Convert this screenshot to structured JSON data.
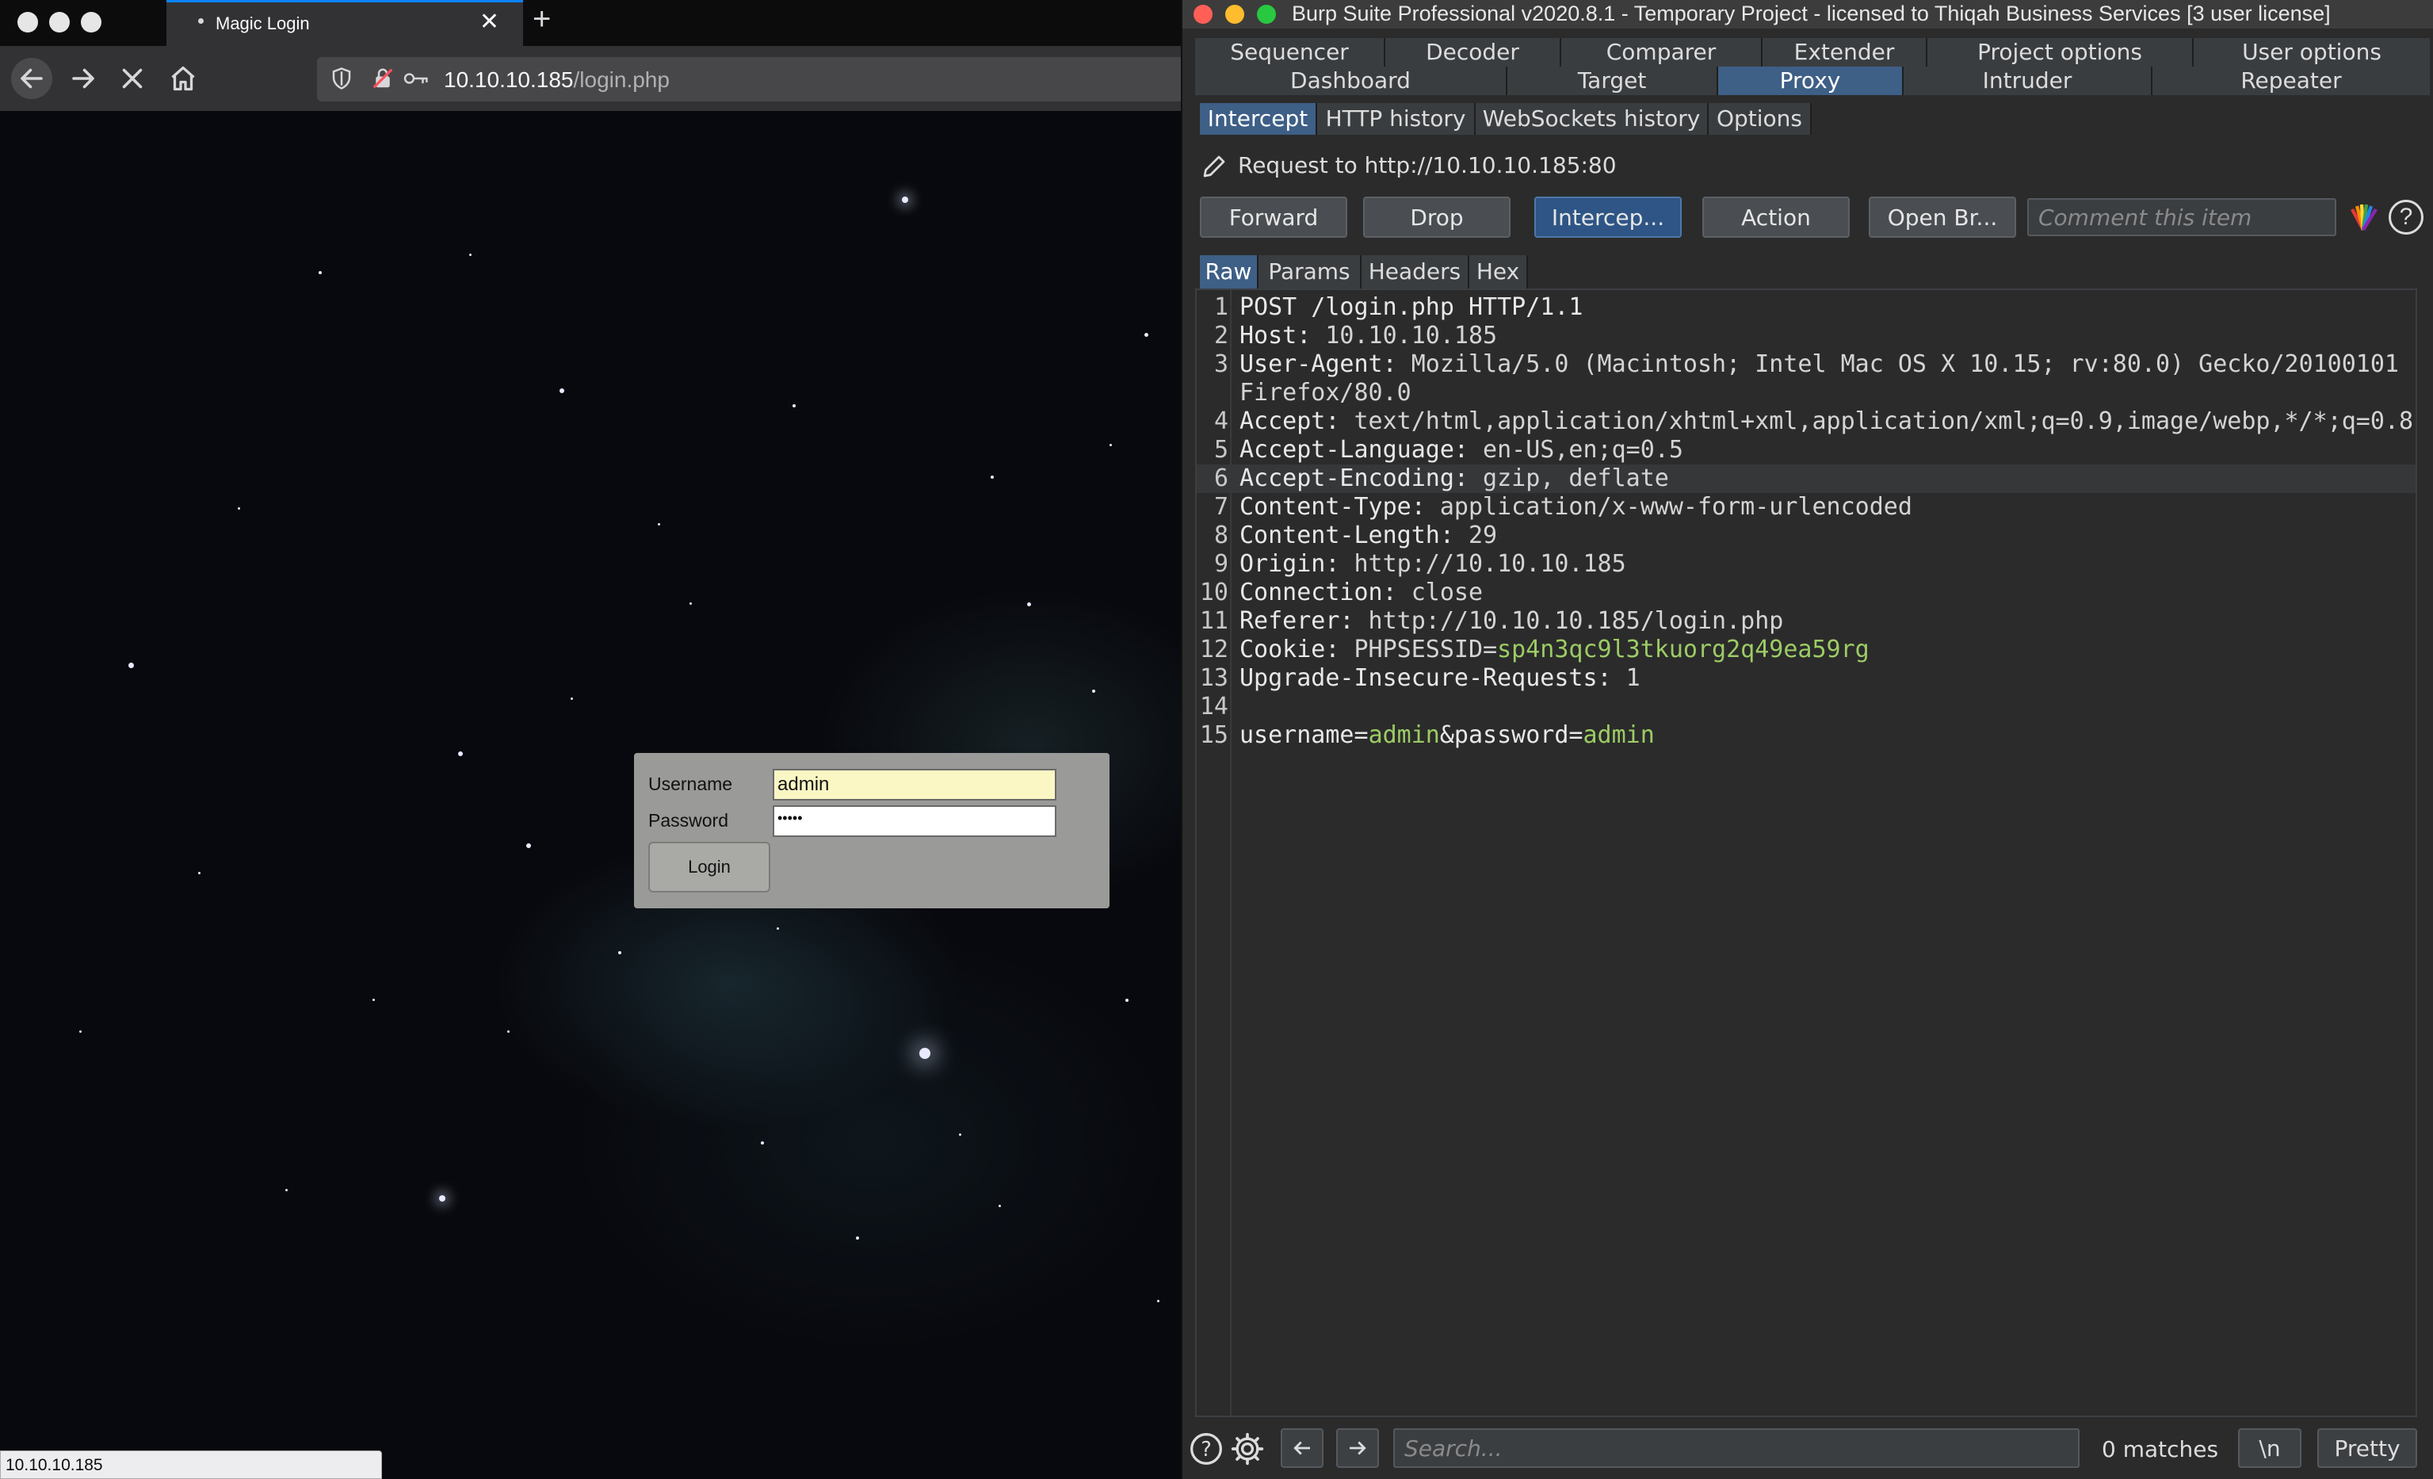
{
  "firefox": {
    "tab_title": "Magic Login",
    "url_host": "10.10.10.185",
    "url_path": "/login.php",
    "status_text": "10.10.10.185",
    "login": {
      "username_label": "Username",
      "password_label": "Password",
      "username_value": "admin",
      "password_value": "•••••",
      "button_label": "Login"
    }
  },
  "burp": {
    "title": "Burp Suite Professional v2020.8.1 - Temporary Project - licensed to Thiqah Business Services [3 user license]",
    "tabs_row1": [
      "Sequencer",
      "Decoder",
      "Comparer",
      "Extender",
      "Project options",
      "User options"
    ],
    "tabs_row2": [
      "Dashboard",
      "Target",
      "Proxy",
      "Intruder",
      "Repeater"
    ],
    "active_tab": "Proxy",
    "proxy_tabs": [
      "Intercept",
      "HTTP history",
      "WebSockets history",
      "Options"
    ],
    "request_to": "Request to http://10.10.10.185:80",
    "buttons": {
      "forward": "Forward",
      "drop": "Drop",
      "intercept": "Intercep...",
      "action": "Action",
      "open_browser": "Open Br..."
    },
    "comment_placeholder": "Comment this item",
    "view_tabs": [
      "Raw",
      "Params",
      "Headers",
      "Hex"
    ],
    "request_lines": [
      {
        "n": "1",
        "key": "POST /login.php HTTP/1.1",
        "val": ""
      },
      {
        "n": "2",
        "key": "Host:",
        "val": " 10.10.10.185"
      },
      {
        "n": "3",
        "key": "User-Agent:",
        "val": " Mozilla/5.0 (Macintosh; Intel Mac OS X 10.15; rv:80.0) Gecko/20100101 Firefox/80.0"
      },
      {
        "n": "4",
        "key": "Accept:",
        "val": " text/html,application/xhtml+xml,application/xml;q=0.9,image/webp,*/*;q=0.8"
      },
      {
        "n": "5",
        "key": "Accept-Language:",
        "val": " en-US,en;q=0.5"
      },
      {
        "n": "6",
        "key": "Accept-Encoding:",
        "val": " gzip, deflate"
      },
      {
        "n": "7",
        "key": "Content-Type:",
        "val": " application/x-www-form-urlencoded"
      },
      {
        "n": "8",
        "key": "Content-Length:",
        "val": " 29"
      },
      {
        "n": "9",
        "key": "Origin:",
        "val": " http://10.10.10.185"
      },
      {
        "n": "10",
        "key": "Connection:",
        "val": " close"
      },
      {
        "n": "11",
        "key": "Referer:",
        "val": " http://10.10.10.185/login.php"
      },
      {
        "n": "12",
        "key": "Cookie:",
        "val": " PHPSESSID=",
        "green": "sp4n3qc9l3tkuorg2q49ea59rg"
      },
      {
        "n": "13",
        "key": "Upgrade-Insecure-Requests:",
        "val": " 1"
      },
      {
        "n": "14",
        "key": "",
        "val": ""
      },
      {
        "n": "15",
        "key": "",
        "val": ""
      }
    ],
    "body": {
      "p1": "username=",
      "v1": "admin",
      "p2": "&password=",
      "v2": "admin"
    },
    "search_placeholder": "Search...",
    "matches": "0 matches",
    "newline_btn": "\\n",
    "pretty_btn": "Pretty"
  },
  "colors": {
    "burp_accent": "#3e5f86",
    "body_value_green": "#9ccc65",
    "firefox_tab_accent": "#0a84ff"
  }
}
